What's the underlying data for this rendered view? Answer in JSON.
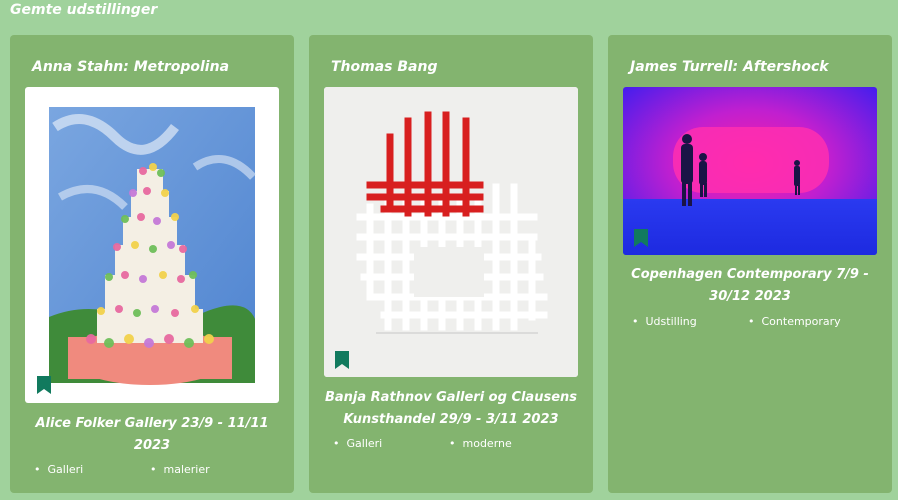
{
  "page": {
    "title": "Gemte udstillinger"
  },
  "cards": [
    {
      "title": "Anna Stahn: Metropolina",
      "venue_line1": "Alice Folker Gallery 23/9 - 11/11",
      "venue_line2": "2023",
      "tags": [
        "Galleri",
        "malerier"
      ],
      "image_icon": "cake-painting-image",
      "bookmark_icon": "bookmark-icon"
    },
    {
      "title": "Thomas Bang",
      "venue_line1": "Banja Rathnov Galleri og Clausens",
      "venue_line2": "Kunsthandel 29/9 - 3/11 2023",
      "tags": [
        "Galleri",
        "moderne"
      ],
      "image_icon": "grid-sculpture-image",
      "bookmark_icon": "bookmark-icon"
    },
    {
      "title": "James Turrell: Aftershock",
      "venue_line1": "Copenhagen Contemporary 7/9 -",
      "venue_line2": "30/12 2023",
      "tags": [
        "Udstilling",
        "Contemporary"
      ],
      "image_icon": "light-installation-image",
      "bookmark_icon": "bookmark-icon"
    }
  ],
  "colors": {
    "background": "#a0d29c",
    "card": "#83b46f",
    "bookmark": "#117a5e",
    "text": "#ffffff"
  }
}
